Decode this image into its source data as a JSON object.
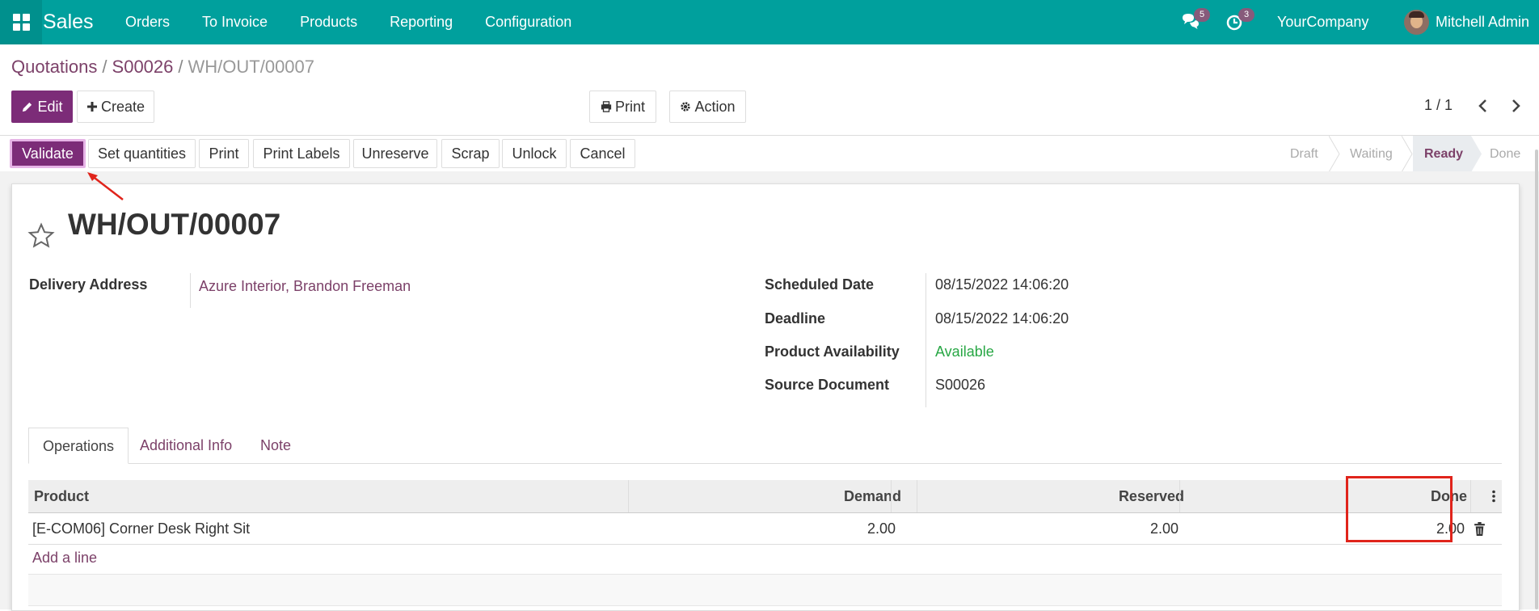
{
  "navbar": {
    "brand": "Sales",
    "menu": [
      "Orders",
      "To Invoice",
      "Products",
      "Reporting",
      "Configuration"
    ],
    "messages_badge": "5",
    "activities_badge": "3",
    "company": "YourCompany",
    "user": "Mitchell Admin"
  },
  "breadcrumb": {
    "items": [
      "Quotations",
      "S00026"
    ],
    "current": "WH/OUT/00007"
  },
  "buttons": {
    "edit": "Edit",
    "create": "Create",
    "print": "Print",
    "action": "Action"
  },
  "pager": {
    "text": "1 / 1"
  },
  "statusbar": {
    "buttons": [
      "Validate",
      "Set quantities",
      "Print",
      "Print Labels",
      "Unreserve",
      "Scrap",
      "Unlock",
      "Cancel"
    ],
    "stages": [
      "Draft",
      "Waiting",
      "Ready",
      "Done"
    ],
    "active_stage": "Ready"
  },
  "record": {
    "title": "WH/OUT/00007",
    "delivery_address_label": "Delivery Address",
    "delivery_address": "Azure Interior, Brandon Freeman",
    "scheduled_date_label": "Scheduled Date",
    "scheduled_date": "08/15/2022 14:06:20",
    "deadline_label": "Deadline",
    "deadline": "08/15/2022 14:06:20",
    "availability_label": "Product Availability",
    "availability": "Available",
    "source_label": "Source Document",
    "source": "S00026"
  },
  "tabs": [
    "Operations",
    "Additional Info",
    "Note"
  ],
  "table": {
    "headers": {
      "product": "Product",
      "demand": "Demand",
      "reserved": "Reserved",
      "done": "Done"
    },
    "rows": [
      {
        "product": "[E-COM06] Corner Desk Right Sit",
        "demand": "2.00",
        "reserved": "2.00",
        "done": "2.00"
      }
    ],
    "add_line": "Add a line"
  },
  "colors": {
    "navbar": "#00a09d",
    "primary": "#7c2c78",
    "link": "#7c4169",
    "available": "#28a745",
    "highlight": "#e0241b"
  }
}
